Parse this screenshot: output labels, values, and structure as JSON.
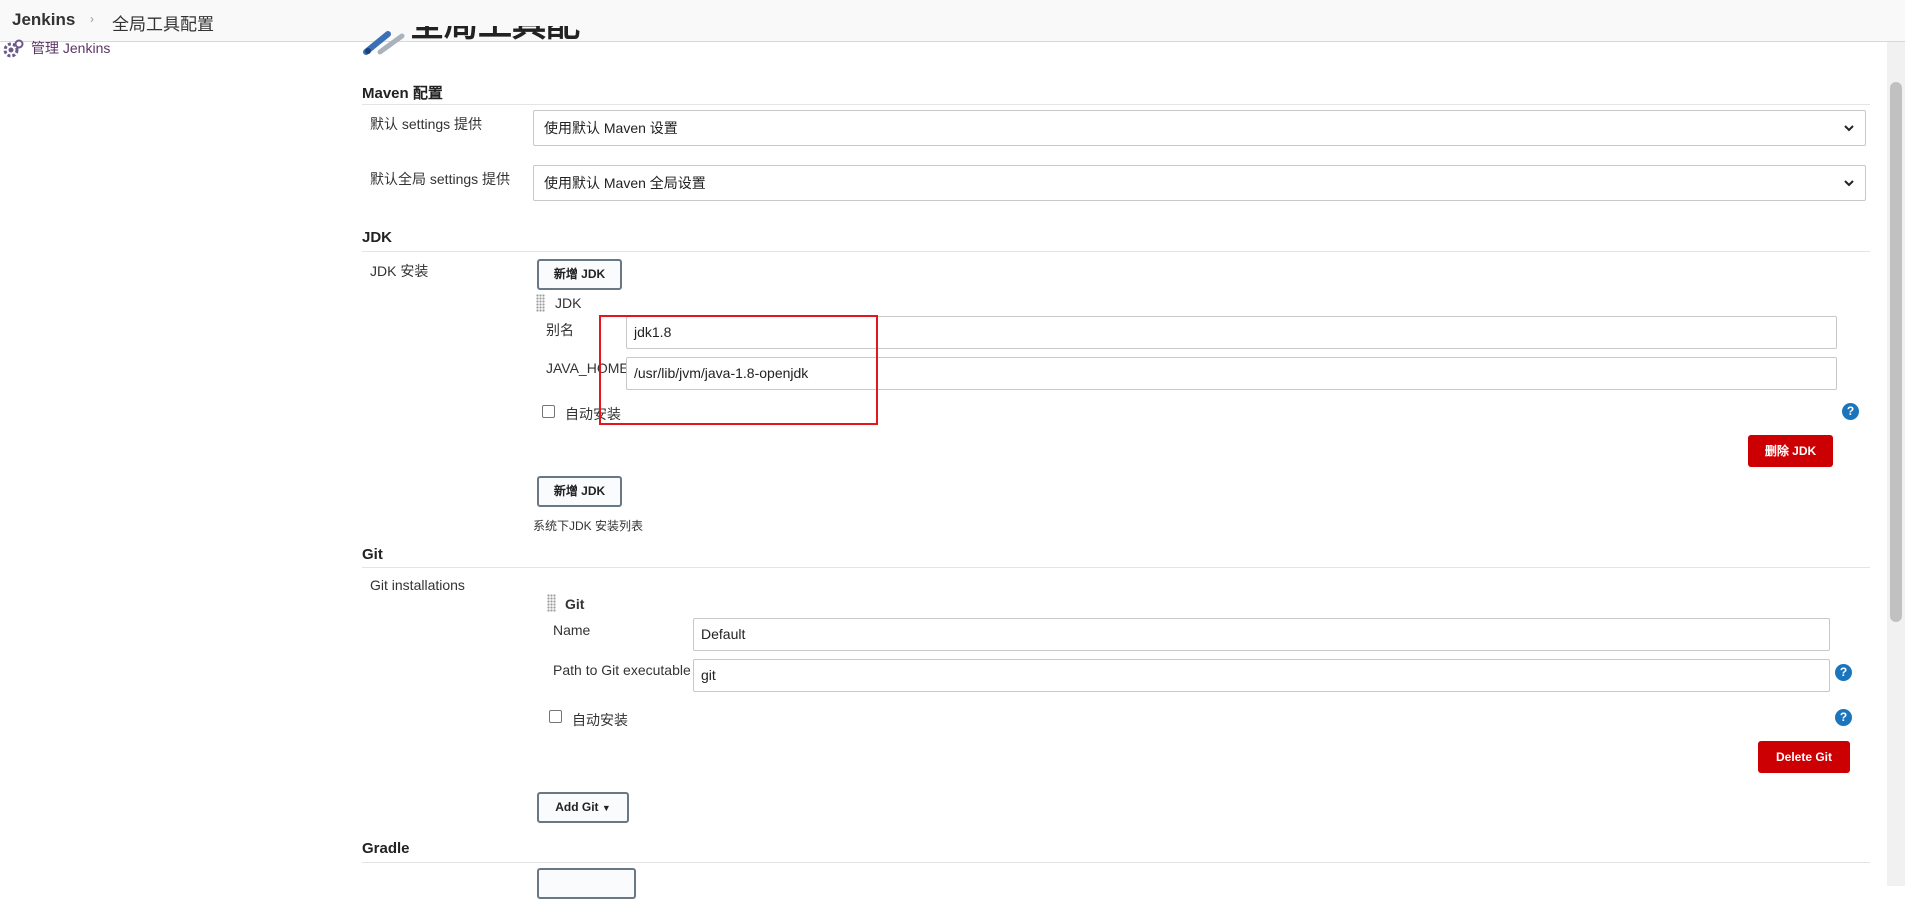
{
  "breadcrumb": {
    "home": "Jenkins",
    "separator": "›",
    "current": "全局工具配置"
  },
  "side_panel": {
    "manage_link": "管理 Jenkins"
  },
  "page_header": {
    "title": "全局工具配置"
  },
  "maven": {
    "heading": "Maven 配置",
    "settings_label": "默认 settings 提供",
    "settings_value": "使用默认 Maven 设置",
    "global_settings_label": "默认全局 settings 提供",
    "global_settings_value": "使用默认 Maven 全局设置"
  },
  "jdk": {
    "heading": "JDK",
    "install_label": "JDK 安装",
    "add_button_top": "新增 JDK",
    "entry_title": "JDK",
    "alias_label": "别名",
    "alias_value": "jdk1.8",
    "java_home_label": "JAVA_HOME",
    "java_home_value": "/usr/lib/jvm/java-1.8-openjdk",
    "auto_install_label": "自动安装",
    "delete_button": "删除 JDK",
    "add_button_bottom": "新增 JDK",
    "list_caption": "系统下JDK 安装列表"
  },
  "git": {
    "heading": "Git",
    "installations_label": "Git installations",
    "entry_title": "Git",
    "name_label": "Name",
    "name_value": "Default",
    "path_label": "Path to Git executable",
    "path_value": "git",
    "auto_install_label": "自动安装",
    "delete_button": "Delete Git",
    "add_button": "Add Git"
  },
  "gradle": {
    "heading": "Gradle"
  },
  "colors": {
    "danger": "#cc0003",
    "help": "#1a75bc",
    "annotation": "#e4151b"
  },
  "icons": [
    "gear-icon",
    "wrench-tools-icon",
    "chevron-down-icon",
    "help-icon",
    "drag-handle-icon",
    "caret-down-icon"
  ]
}
